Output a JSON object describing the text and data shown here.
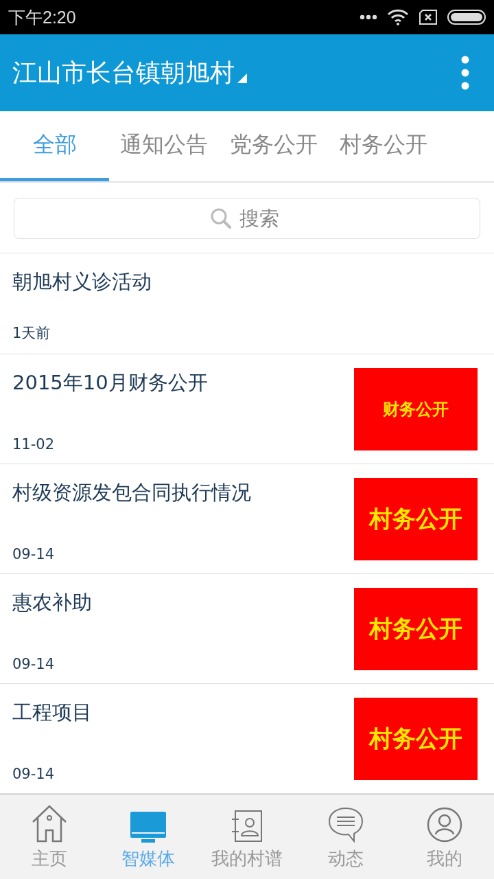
{
  "status_bar": {
    "time": "下午2:20"
  },
  "app_bar": {
    "title": "江山市长台镇朝旭村"
  },
  "tabs": [
    {
      "label": "全部",
      "selected": true
    },
    {
      "label": "通知公告",
      "selected": false
    },
    {
      "label": "党务公开",
      "selected": false
    },
    {
      "label": "村务公开",
      "selected": false
    }
  ],
  "search": {
    "placeholder": "搜索"
  },
  "articles": [
    {
      "title": "朝旭村义诊活动",
      "date": "1天前"
    },
    {
      "title": "2015年10月财务公开",
      "date": "11-02",
      "thumbnail_text": "财务公开",
      "kind": "small"
    },
    {
      "title": "村级资源发包合同执行情况",
      "date": "09-14",
      "thumbnail_text": "村务公开",
      "kind": "large"
    },
    {
      "title": "惠农补助",
      "date": "09-14",
      "thumbnail_text": "村务公开",
      "kind": "large"
    },
    {
      "title": "工程项目",
      "date": "09-14",
      "thumbnail_text": "村务公开",
      "kind": "large"
    }
  ],
  "bottom_nav": [
    {
      "kind": "home",
      "label": "主页",
      "selected": false
    },
    {
      "kind": "media",
      "label": "智媒体",
      "selected": true
    },
    {
      "kind": "contacts",
      "label": "我的村谱",
      "selected": false
    },
    {
      "kind": "chat",
      "label": "动态",
      "selected": false
    },
    {
      "kind": "profile",
      "label": "我的",
      "selected": false
    }
  ]
}
